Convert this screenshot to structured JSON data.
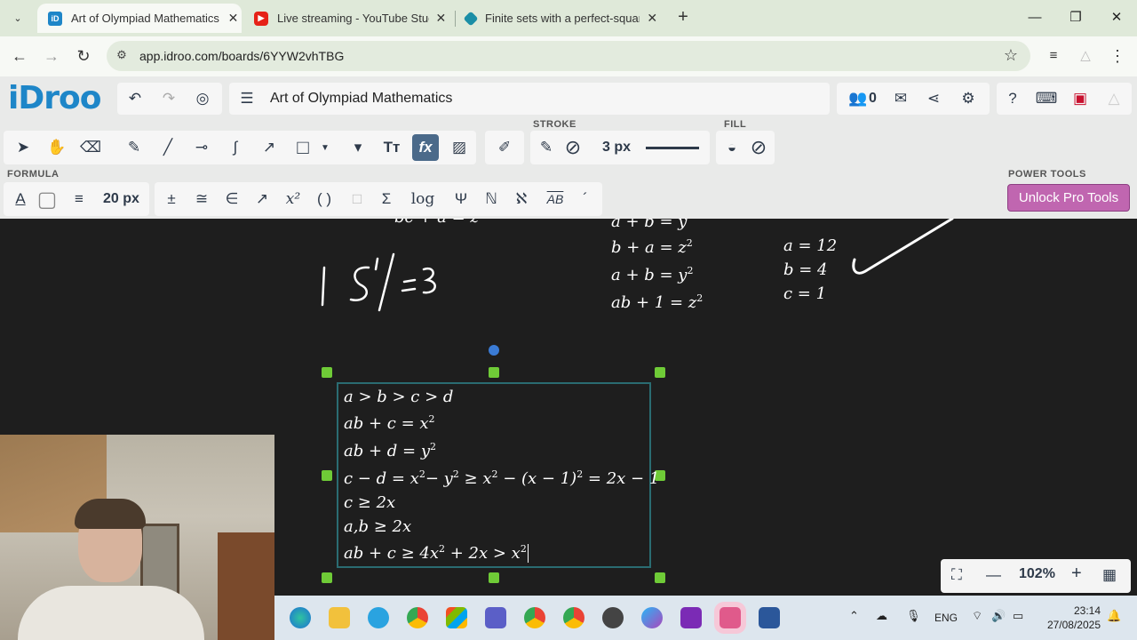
{
  "browser": {
    "tabs": [
      {
        "title": "Art of Olympiad Mathematics -",
        "active": true,
        "favicon": "iD"
      },
      {
        "title": "Live streaming - YouTube Studio",
        "active": false,
        "favicon": "youtube-icon"
      },
      {
        "title": "Finite sets with a perfect-square",
        "active": false,
        "favicon": "cube-icon"
      }
    ],
    "url": "app.idroo.com/boards/6YYW2vhTBG"
  },
  "app": {
    "logo": "iDroo",
    "board_title": "Art of Olympiad Mathematics",
    "user_count": "0",
    "stroke_label": "STROKE",
    "fill_label": "FILL",
    "stroke_width": "3 px",
    "formula_label": "FORMULA",
    "font_size": "20 px",
    "power_tools_label": "POWER TOOLS",
    "unlock_button": "Unlock Pro Tools",
    "formula_tools": [
      "±",
      "≅",
      "∈",
      "↗",
      "x²",
      "( )",
      "□",
      "Σ",
      "log",
      "Ψ",
      "ℕ",
      "ℵ",
      "AB",
      "´"
    ]
  },
  "canvas": {
    "top_fragment": "bc + a = z",
    "handwriting": "| S' | = 3",
    "system": [
      "a + b = y",
      "b + a = z",
      "a + b = y",
      "ab + 1 = z"
    ],
    "system_exponents": [
      "",
      "2",
      "2",
      "2"
    ],
    "values": [
      "a = 12",
      "b = 4",
      "c = 1"
    ],
    "formula_lines": [
      "a > b > c > d",
      "ab + c = x",
      "ab + d = y",
      "c − d = x",
      "c ≥ 2x",
      "a,b ≥ 2x",
      "ab + c ≥ 4x"
    ],
    "formula_line4_rest": [
      "− y",
      " ≥ x",
      " − (x − 1)",
      " = 2x − 1"
    ],
    "formula_line7_rest": [
      " + 2x > x"
    ]
  },
  "zoom": {
    "level": "102%"
  },
  "taskbar": {
    "language": "ENG",
    "time": "23:14",
    "date": "27/08/2025"
  }
}
